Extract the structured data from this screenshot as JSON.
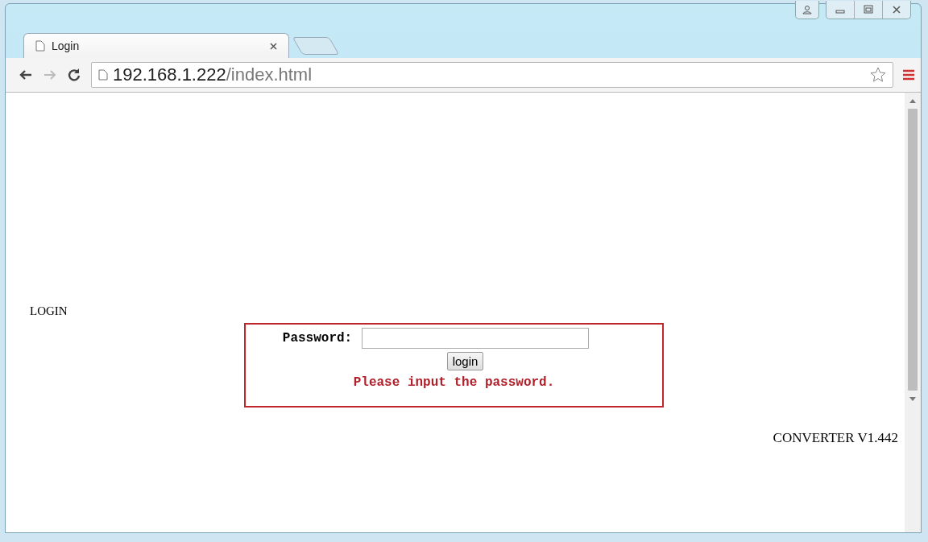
{
  "browser": {
    "tab": {
      "title": "Login",
      "selected": true
    },
    "address": {
      "host": "192.168.1.222",
      "path": "/index.html"
    }
  },
  "page": {
    "heading": "LOGIN",
    "form": {
      "label": "Password:",
      "button": "login",
      "message": "Please input the password."
    },
    "version": "CONVERTER V1.442"
  }
}
